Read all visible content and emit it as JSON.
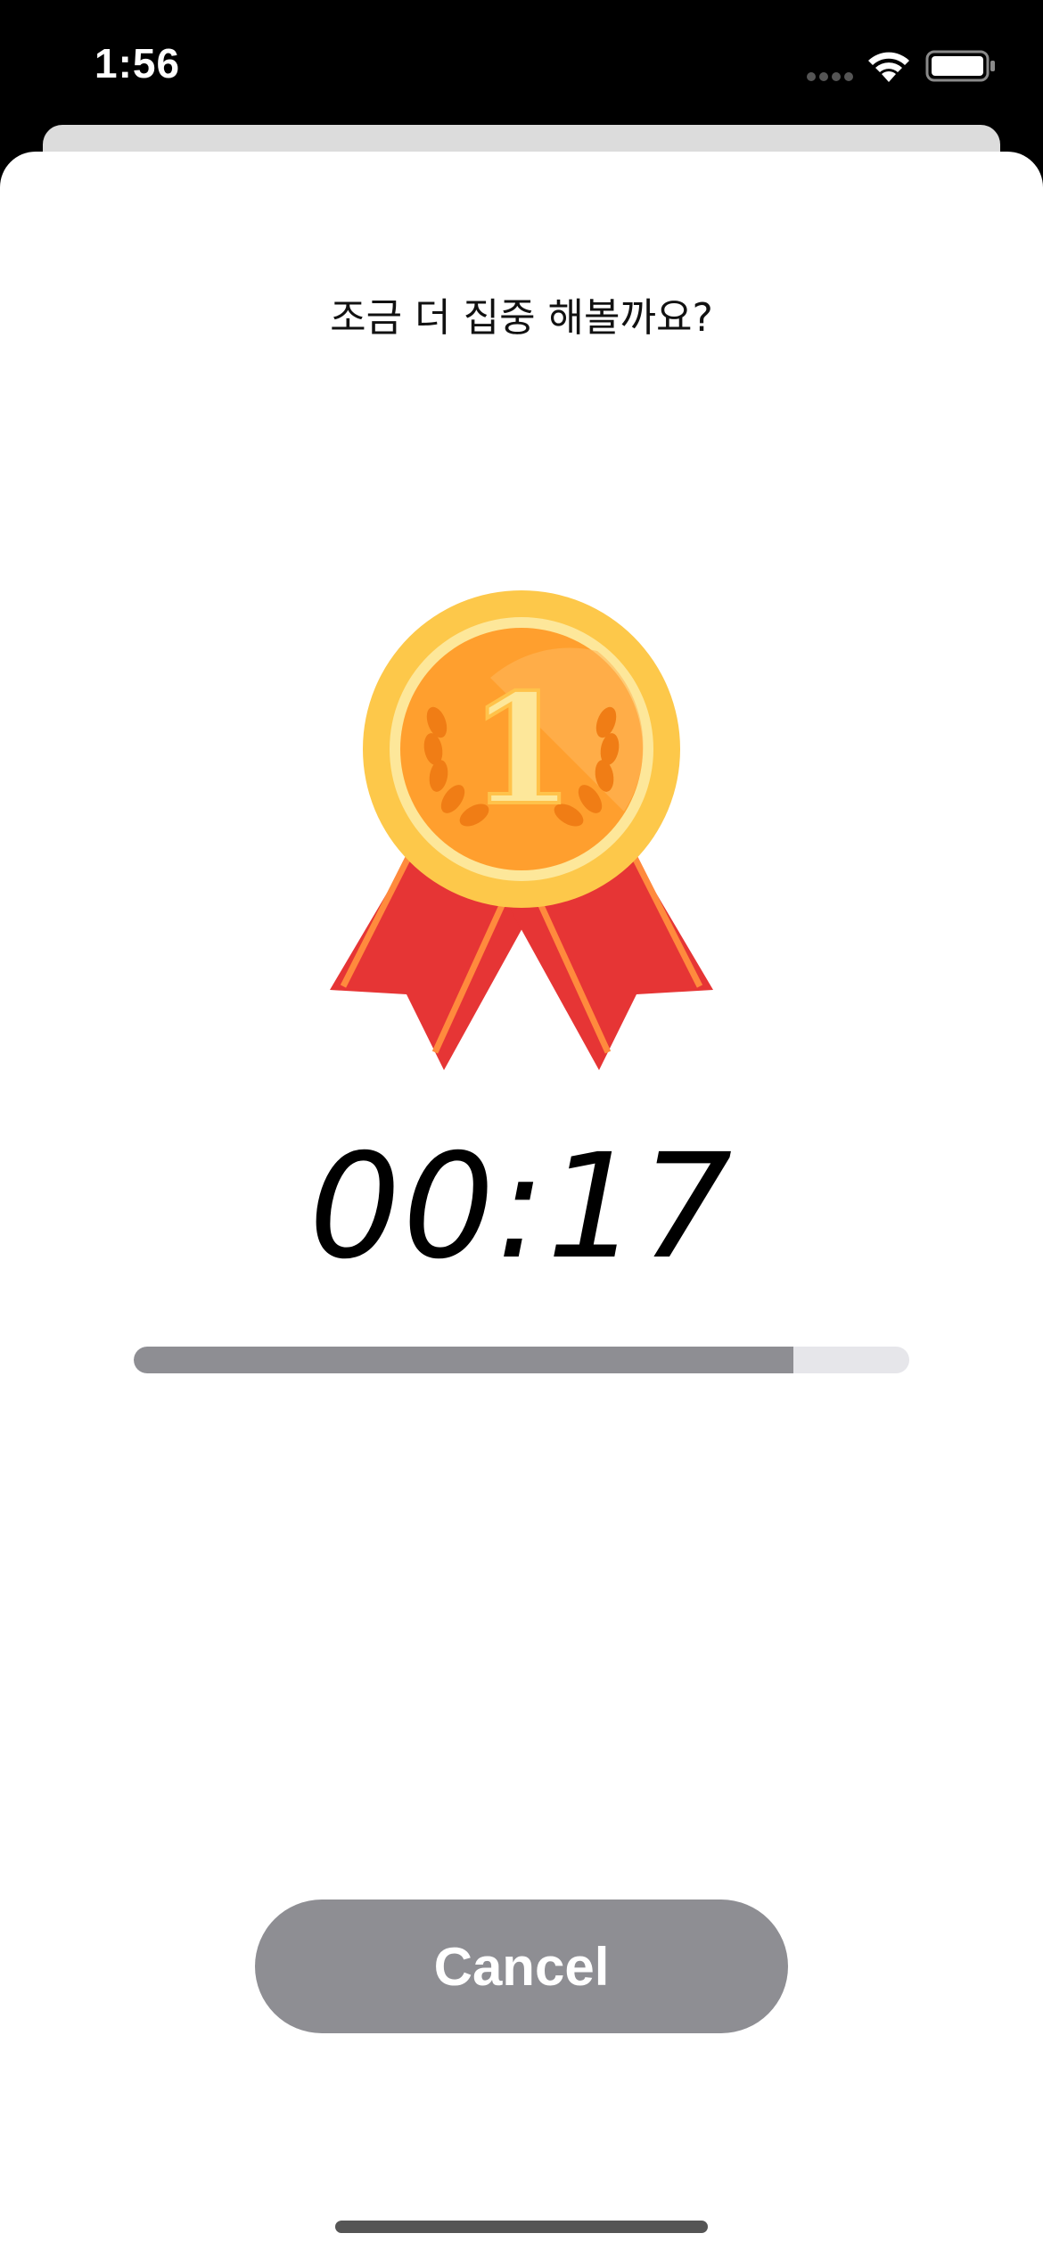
{
  "status_bar": {
    "time": "1:56"
  },
  "sheet": {
    "prompt": "조금 더 집중 해볼까요?",
    "medal_rank": "1",
    "timer": "00:17",
    "progress": 0.85,
    "cancel_label": "Cancel"
  },
  "colors": {
    "progress_fill": "#8e8e93",
    "progress_track": "#e6e6ea",
    "button": "#8e8e93",
    "medal_gold": "#fdc84a",
    "medal_orange": "#ff9f2e",
    "ribbon_red": "#e63535"
  }
}
